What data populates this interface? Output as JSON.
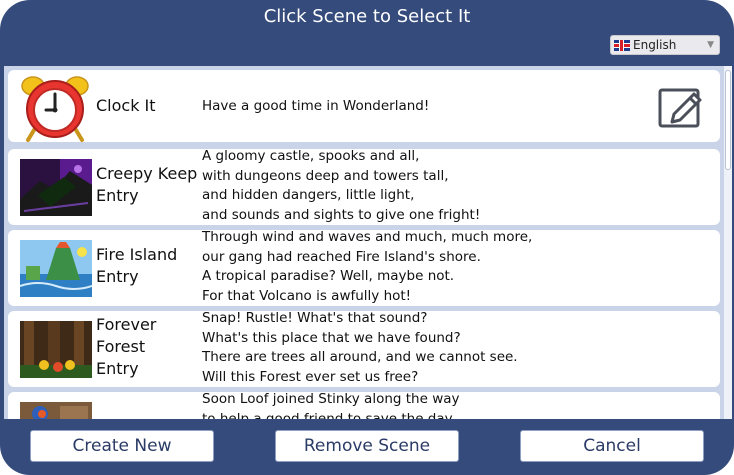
{
  "dialog": {
    "title": "Click Scene to Select It",
    "language": {
      "selected": "English",
      "icon": "uk-flag-icon"
    }
  },
  "scenes": [
    {
      "name": "Clock It",
      "lines": [
        "Have a good time in Wonderland!"
      ],
      "thumb_icon": "alarm-clock-icon",
      "has_edit": true
    },
    {
      "name": "Creepy Keep Entry",
      "lines": [
        "A gloomy castle, spooks and all,",
        "with dungeons deep and towers tall,",
        "and hidden dangers, little light,",
        "and sounds and sights to give one fright!"
      ],
      "thumb_icon": "creepy-keep-thumbnail"
    },
    {
      "name": "Fire Island Entry",
      "lines": [
        "Through wind and waves and much, much more,",
        "our gang had reached Fire Island's shore.",
        "A tropical paradise? Well, maybe not.",
        "For that Volcano is awfully hot!"
      ],
      "thumb_icon": "fire-island-thumbnail"
    },
    {
      "name": "Forever Forest Entry",
      "lines": [
        "Snap! Rustle! What's that sound?",
        "What's this place that we have found?",
        "There are trees all around, and we cannot see.",
        "Will this Forest ever set us free?"
      ],
      "thumb_icon": "forever-forest-thumbnail"
    },
    {
      "name": "",
      "lines": [
        "Soon Loof joined Stinky along the way",
        "to help a good friend to save the day"
      ],
      "thumb_icon": "partial-thumbnail"
    }
  ],
  "buttons": {
    "create_new": "Create New",
    "remove_scene": "Remove Scene",
    "cancel": "Cancel"
  },
  "colors": {
    "frame": "#344b7c",
    "list_background": "#c9d4e8",
    "row_background": "#ffffff",
    "button_text": "#2a3b66"
  }
}
